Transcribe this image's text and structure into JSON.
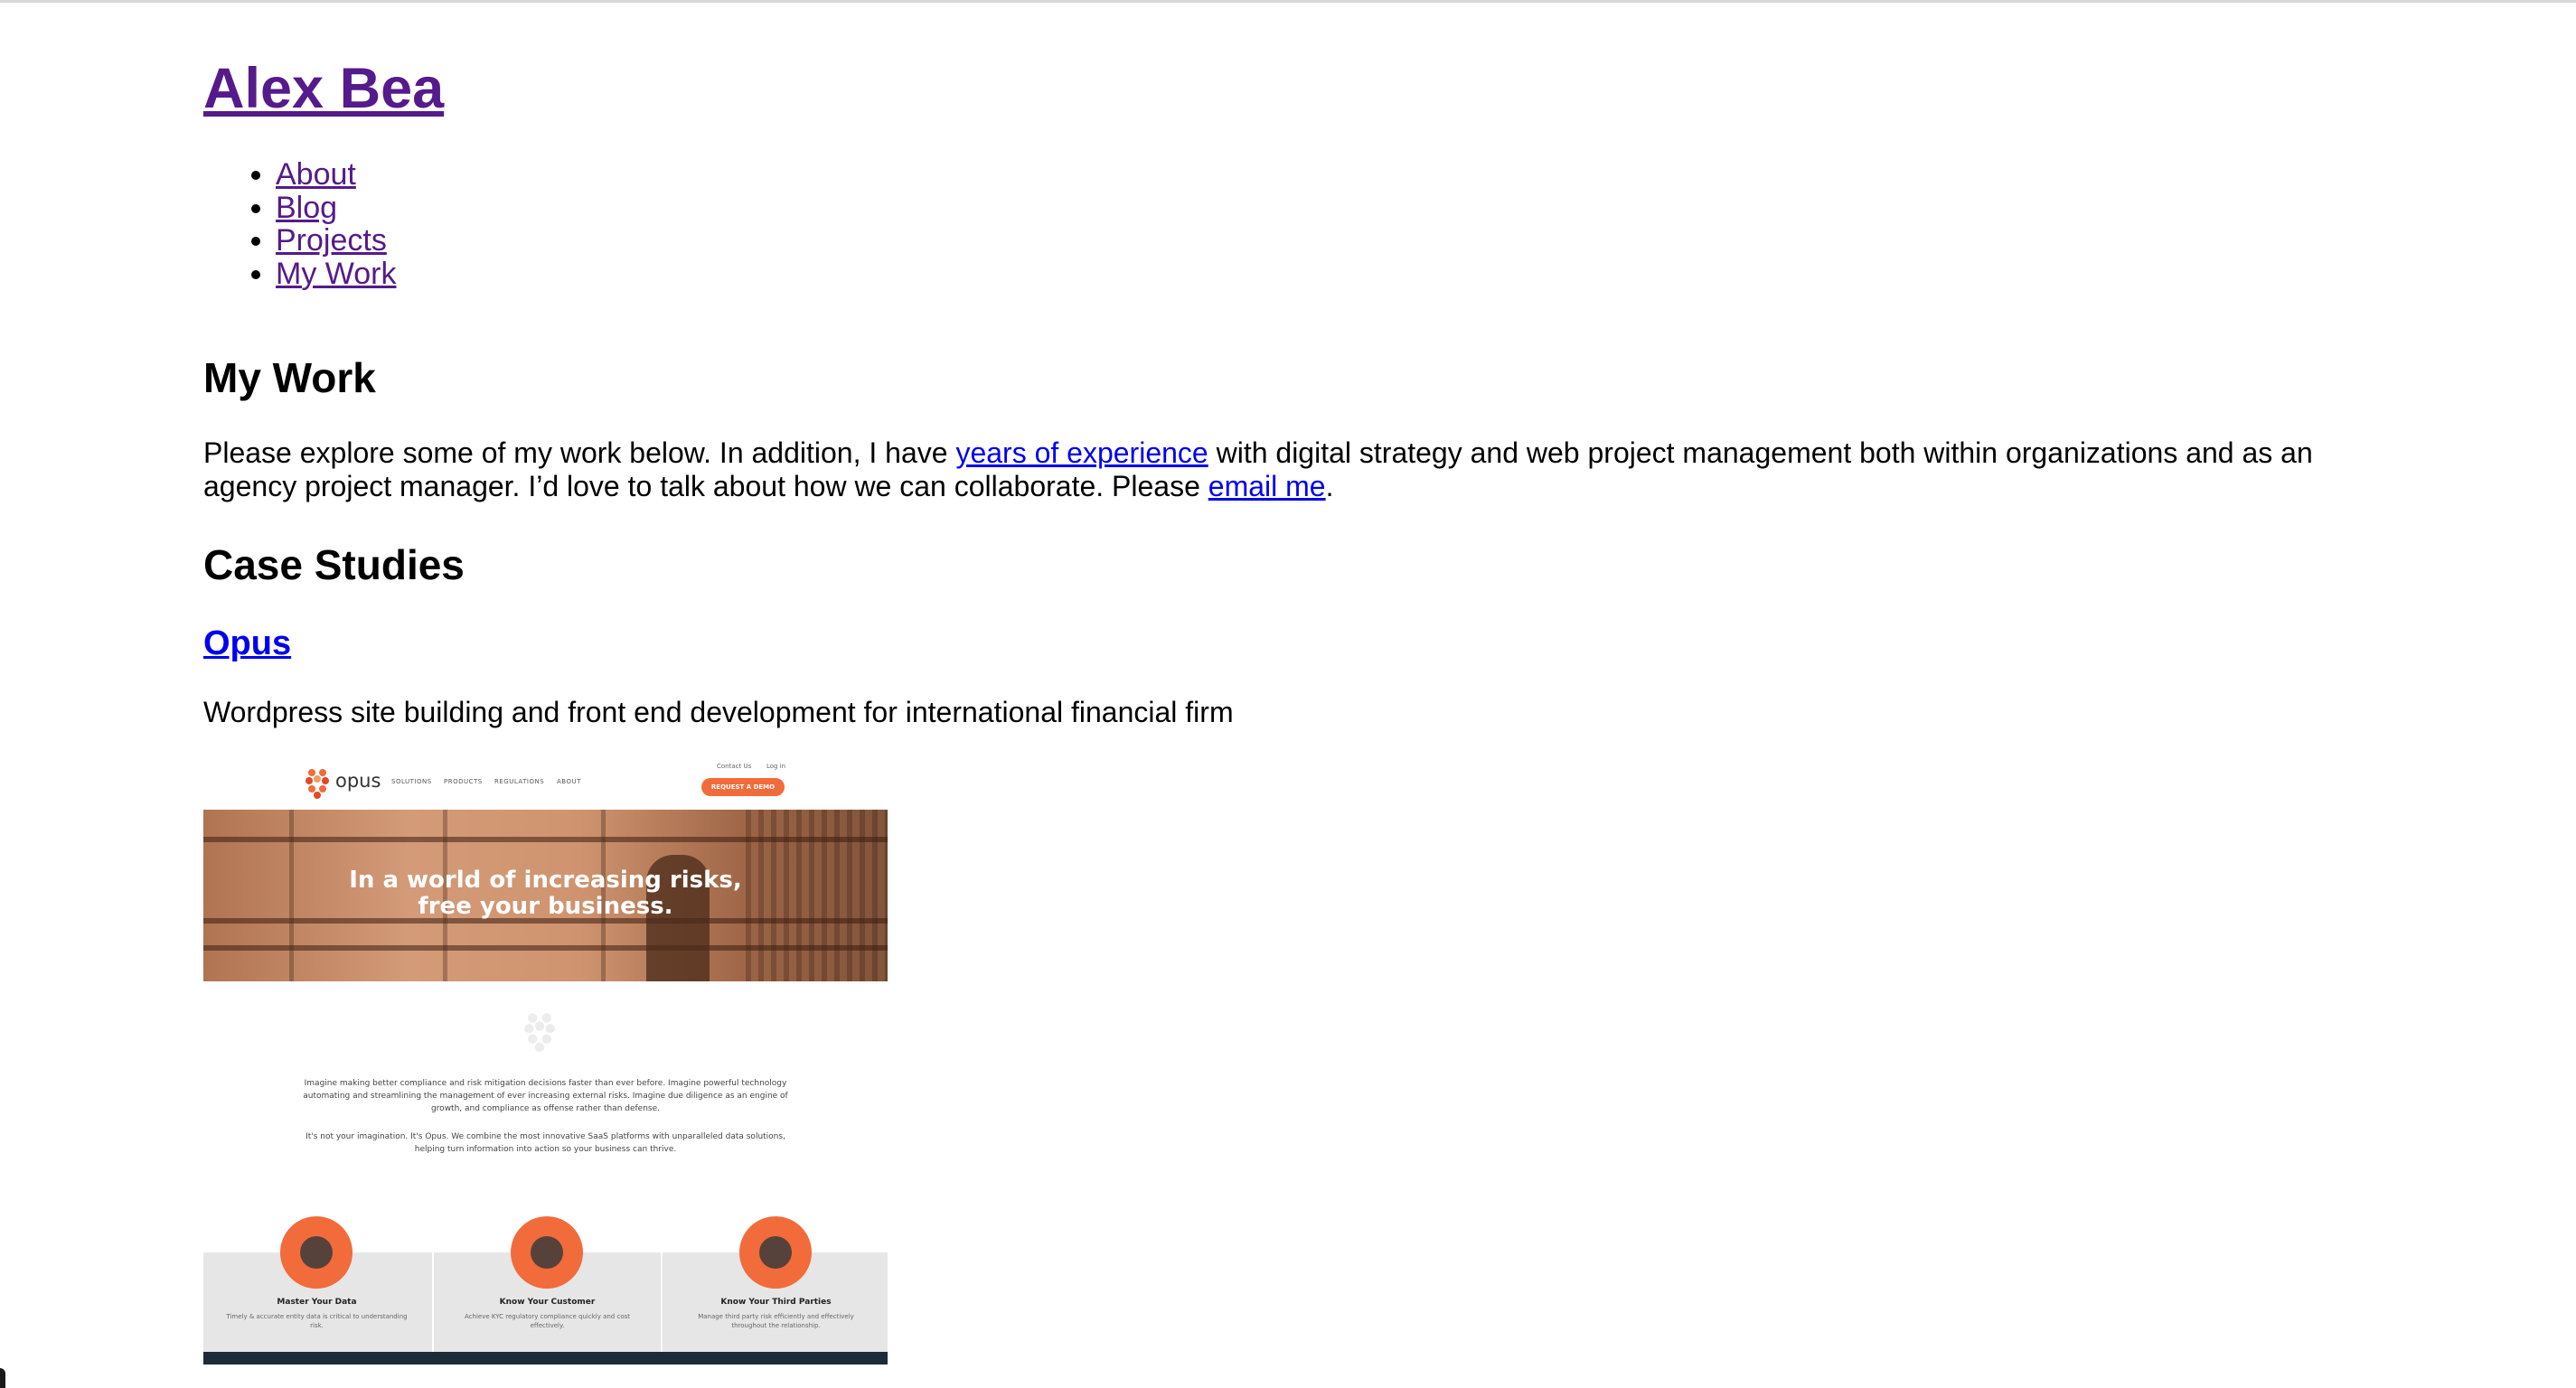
{
  "site": {
    "title": "Alex Bea"
  },
  "nav": {
    "items": [
      {
        "label": "About"
      },
      {
        "label": "Blog"
      },
      {
        "label": "Projects"
      },
      {
        "label": "My Work"
      }
    ]
  },
  "page": {
    "heading": "My Work",
    "intro": {
      "text_before": "Please explore some of my work below. In addition, I have ",
      "link_experience": "years of experience",
      "text_middle": " with digital strategy and web project management both within organizations and as an agency project manager. I’d love to talk about how we can collaborate. Please ",
      "link_email": "email me",
      "text_after": "."
    }
  },
  "case_studies": {
    "heading": "Case Studies",
    "items": [
      {
        "title": "Opus",
        "description": "Wordpress site building and front end development for international financial firm",
        "screenshot": {
          "logo_text": "opus",
          "nav": [
            "SOLUTIONS",
            "PRODUCTS",
            "REGULATIONS",
            "ABOUT"
          ],
          "top_links": [
            "Contact Us",
            "Log in"
          ],
          "cta": "REQUEST A DEMO",
          "hero_line1": "In a world of increasing risks,",
          "hero_line2": "free your business.",
          "para1": "Imagine making better compliance and risk mitigation decisions faster than ever before. Imagine powerful technology automating and streamlining the management of ever increasing external risks. Imagine due diligence as an engine of growth, and compliance as offense rather than defense.",
          "para2": "It's not your imagination. It's Opus. We combine the most innovative SaaS platforms with unparalleled data solutions, helping turn information into action so your business can thrive.",
          "cards": [
            {
              "title": "Master Your Data",
              "text": "Timely & accurate entity data is critical to understanding risk."
            },
            {
              "title": "Know Your Customer",
              "text": "Achieve KYC regulatory compliance quickly and cost effectively."
            },
            {
              "title": "Know Your Third Parties",
              "text": "Manage third party risk efficiently and effectively throughout the relationship."
            }
          ]
        }
      }
    ]
  },
  "colors": {
    "link": "#0000ee",
    "visited": "#551a8b",
    "accent": "#f26b3a"
  }
}
